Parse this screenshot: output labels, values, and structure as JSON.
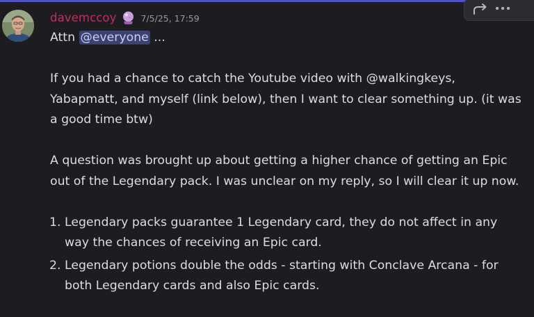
{
  "message": {
    "author": "davemccoy",
    "timestamp": "7/5/25, 17:59",
    "author_color": "#c22f5a",
    "role_icon": "crystal-ball-icon",
    "line1_prefix": "Attn ",
    "mention": "@everyone",
    "line1_suffix": " ...",
    "paragraph2": "If you had a chance to catch the Youtube video with @walkingkeys, Yabapmatt, and myself (link below), then I want to clear something up.  (it was a good time btw)",
    "paragraph3": "A question was brought up about getting a higher chance of getting an Epic out of the Legendary pack.  I was unclear on my reply, so I will clear it up now.",
    "list": [
      {
        "number": "1.",
        "text": "Legendary packs guarantee 1 Legendary card, they do not affect in any way the chances of receiving an Epic card."
      },
      {
        "number": "2.",
        "text": "Legendary potions double the odds - starting with Conclave Arcana - for both Legendary cards and also Epic cards."
      }
    ]
  },
  "toolbar": {
    "icons": [
      "forward-icon",
      "more-options-icon"
    ]
  }
}
